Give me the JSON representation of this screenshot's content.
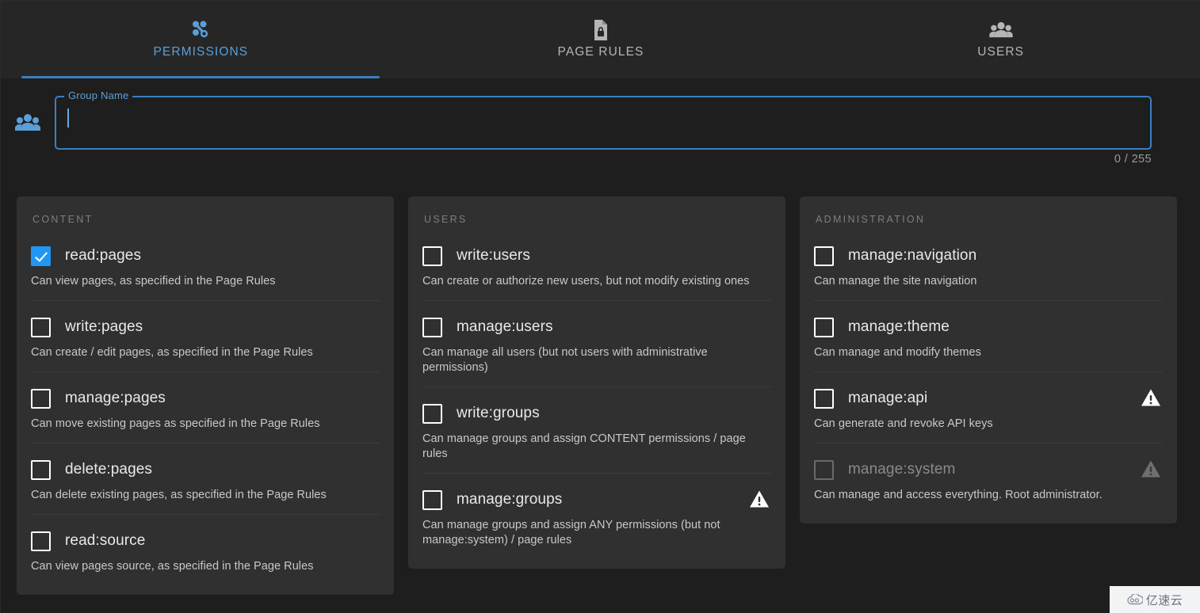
{
  "tabs": [
    {
      "label": "PERMISSIONS",
      "icon": "permissions-nodes-icon",
      "active": true
    },
    {
      "label": "PAGE RULES",
      "icon": "document-lock-icon",
      "active": false
    },
    {
      "label": "USERS",
      "icon": "users-group-icon",
      "active": false
    }
  ],
  "group_field": {
    "avatar_icon": "users-group-icon",
    "label": "Group Name",
    "value": "",
    "placeholder": "",
    "counter": "0 / 255"
  },
  "colors": {
    "accent": "#3a7fc0",
    "accent_text": "#5c9fd8",
    "checkbox_checked": "#2196f3",
    "panel_bg": "#303030",
    "page_bg": "#1e1e1e",
    "tabbar_bg": "#262626"
  },
  "columns": [
    {
      "title": "CONTENT",
      "permissions": [
        {
          "name": "read:pages",
          "description": "Can view pages, as specified in the Page Rules",
          "checked": true,
          "warning": false,
          "disabled": false
        },
        {
          "name": "write:pages",
          "description": "Can create / edit pages, as specified in the Page Rules",
          "checked": false,
          "warning": false,
          "disabled": false
        },
        {
          "name": "manage:pages",
          "description": "Can move existing pages as specified in the Page Rules",
          "checked": false,
          "warning": false,
          "disabled": false
        },
        {
          "name": "delete:pages",
          "description": "Can delete existing pages, as specified in the Page Rules",
          "checked": false,
          "warning": false,
          "disabled": false
        },
        {
          "name": "read:source",
          "description": "Can view pages source, as specified in the Page Rules",
          "checked": false,
          "warning": false,
          "disabled": false
        }
      ]
    },
    {
      "title": "USERS",
      "permissions": [
        {
          "name": "write:users",
          "description": "Can create or authorize new users, but not modify existing ones",
          "checked": false,
          "warning": false,
          "disabled": false
        },
        {
          "name": "manage:users",
          "description": "Can manage all users (but not users with administrative permissions)",
          "checked": false,
          "warning": false,
          "disabled": false
        },
        {
          "name": "write:groups",
          "description": "Can manage groups and assign CONTENT permissions / page rules",
          "checked": false,
          "warning": false,
          "disabled": false
        },
        {
          "name": "manage:groups",
          "description": "Can manage groups and assign ANY permissions (but not manage:system) / page rules",
          "checked": false,
          "warning": true,
          "disabled": false
        }
      ]
    },
    {
      "title": "ADMINISTRATION",
      "permissions": [
        {
          "name": "manage:navigation",
          "description": "Can manage the site navigation",
          "checked": false,
          "warning": false,
          "disabled": false
        },
        {
          "name": "manage:theme",
          "description": "Can manage and modify themes",
          "checked": false,
          "warning": false,
          "disabled": false
        },
        {
          "name": "manage:api",
          "description": "Can generate and revoke API keys",
          "checked": false,
          "warning": true,
          "disabled": false
        },
        {
          "name": "manage:system",
          "description": "Can manage and access everything. Root administrator.",
          "checked": false,
          "warning": true,
          "disabled": true
        }
      ]
    }
  ],
  "watermark": {
    "text": "亿速云",
    "icon": "cloud-icon"
  }
}
